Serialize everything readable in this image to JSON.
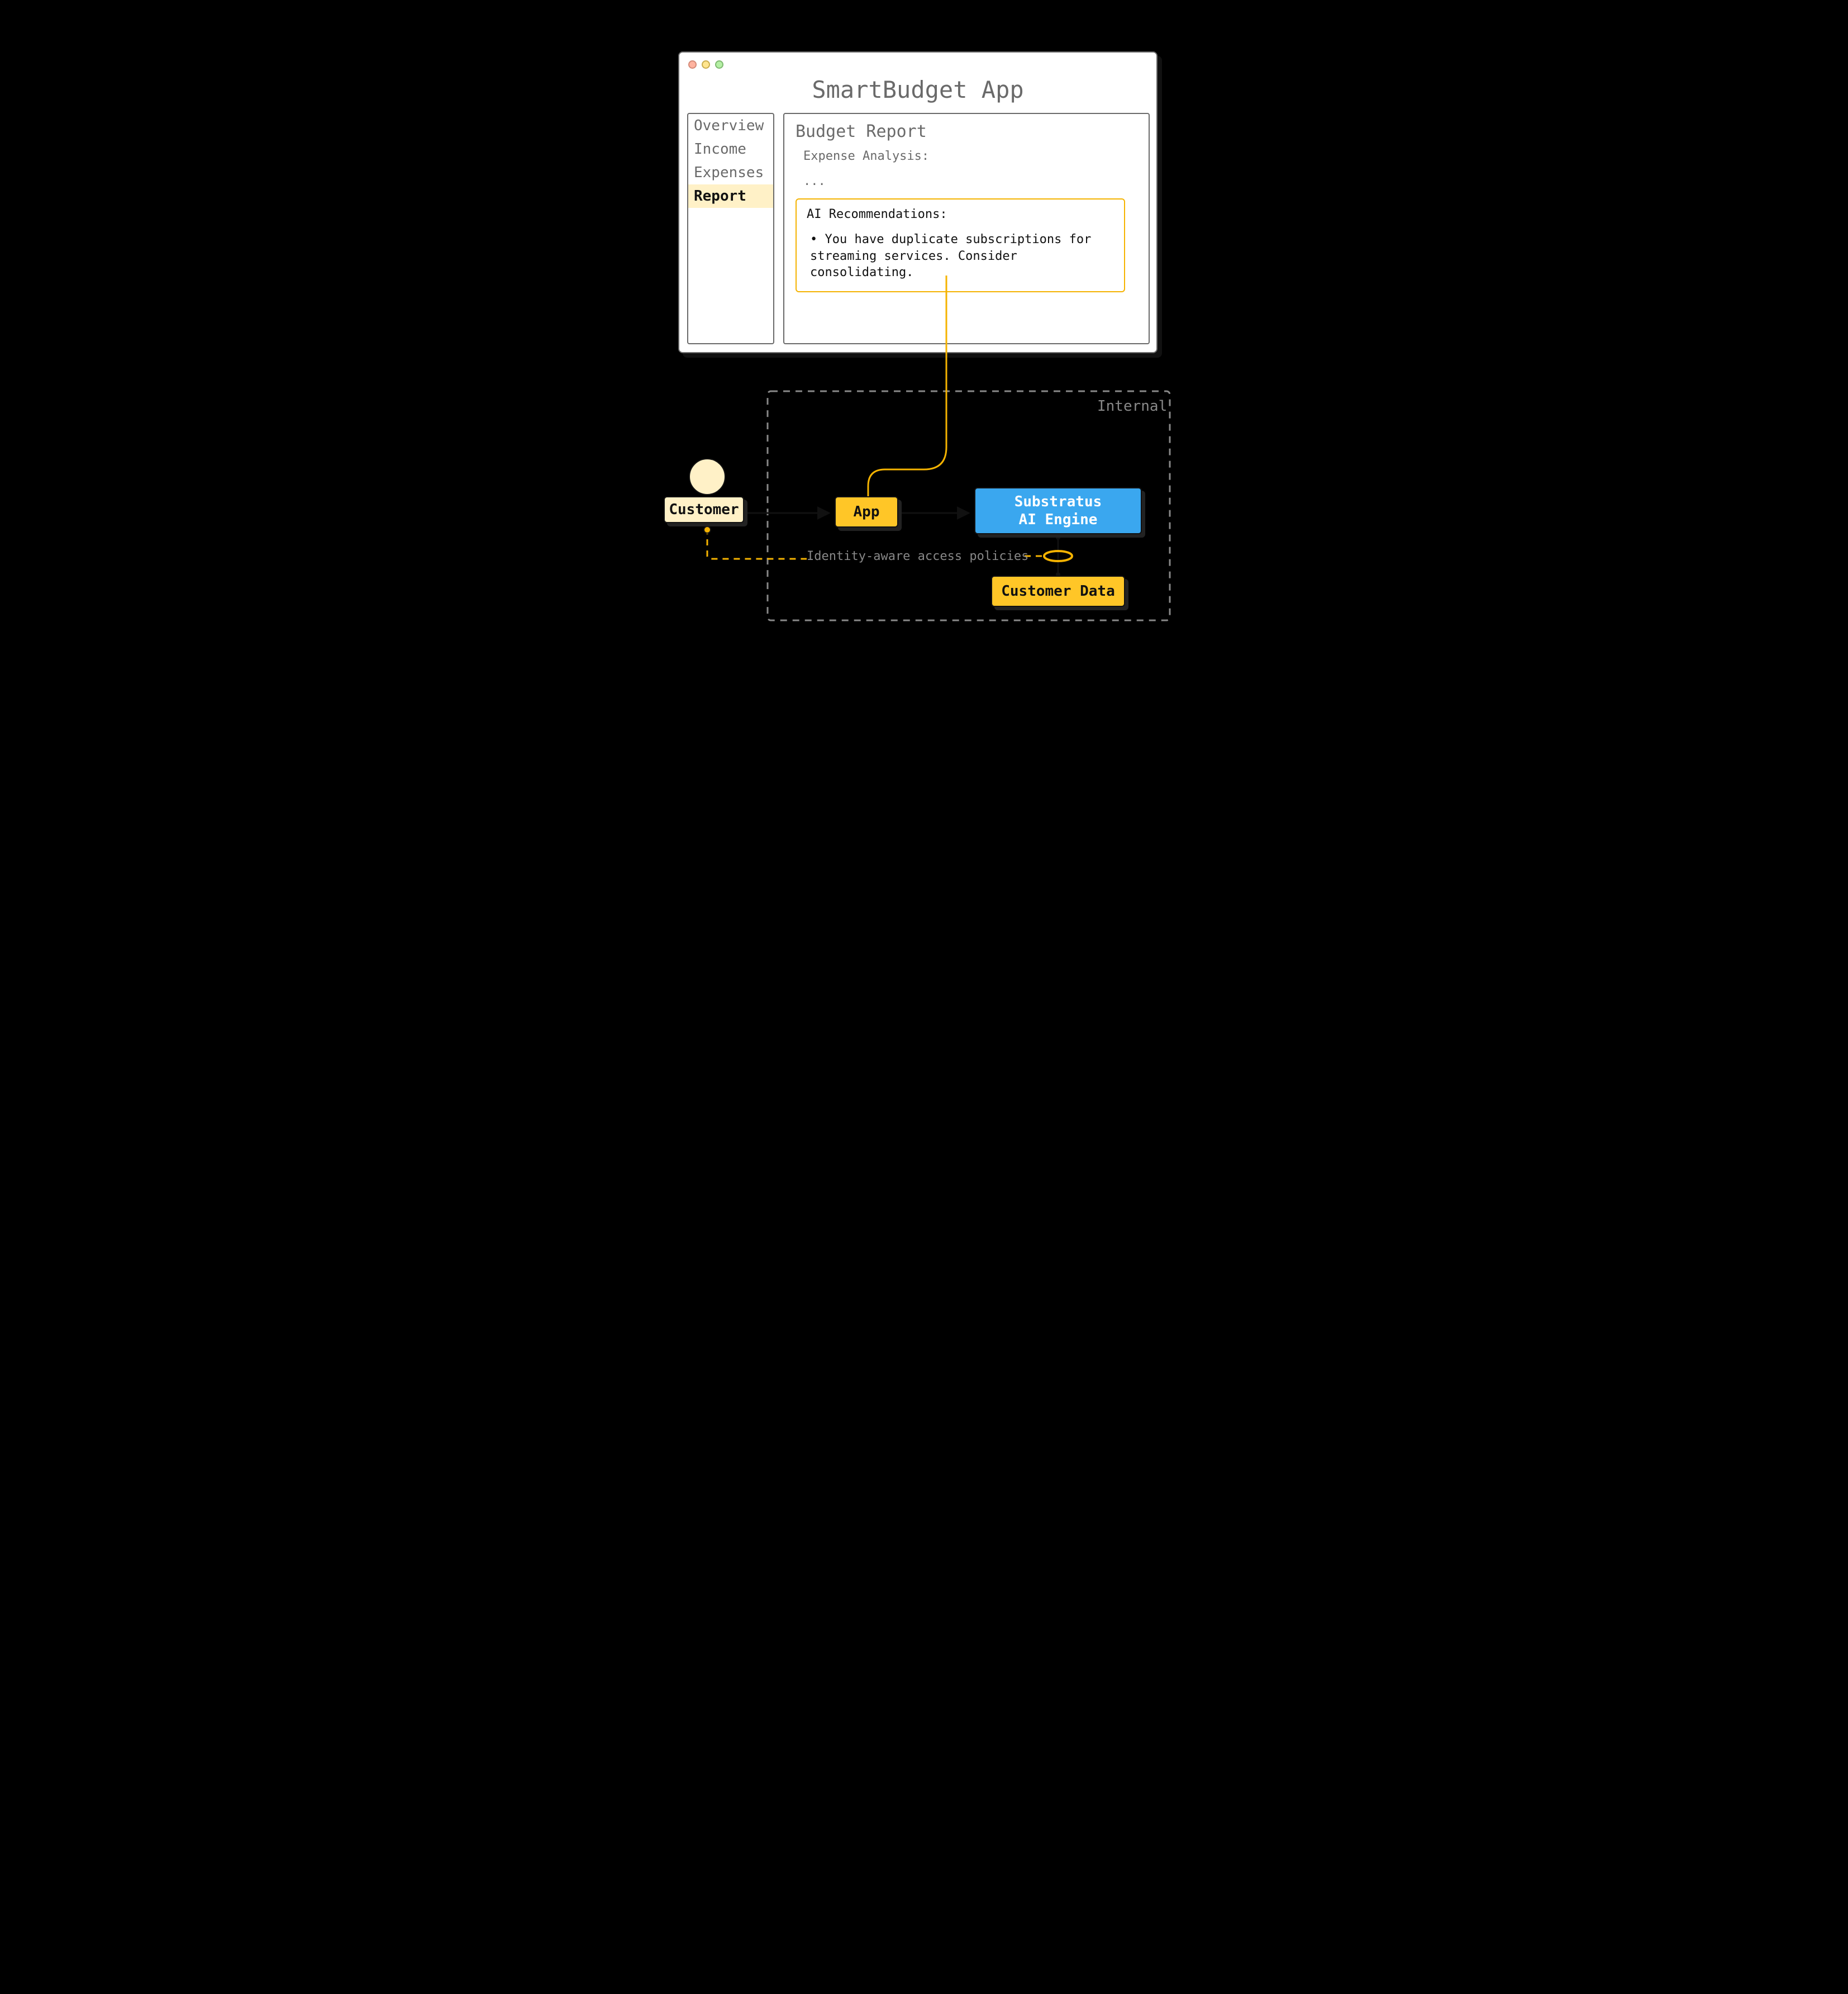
{
  "app": {
    "title": "SmartBudget App",
    "traffic_light_icons": [
      "close-icon",
      "minimize-icon",
      "zoom-icon"
    ]
  },
  "sidebar": {
    "items": [
      {
        "label": "Overview",
        "active": false
      },
      {
        "label": "Income",
        "active": false
      },
      {
        "label": "Expenses",
        "active": false
      },
      {
        "label": "Report",
        "active": true
      }
    ]
  },
  "main": {
    "title": "Budget Report",
    "subheading": "Expense Analysis:",
    "ellipsis": "...",
    "recommendations": {
      "heading": "AI Recommendations:",
      "bullet": "You have duplicate subscriptions for streaming services. Consider consolidating."
    }
  },
  "architecture": {
    "internal_label": "Internal",
    "policy_label": "Identity-aware access policies",
    "nodes": {
      "customer": {
        "label": "Customer"
      },
      "app": {
        "label": "App"
      },
      "engine": {
        "label_line1": "Substratus",
        "label_line2": "AI Engine"
      },
      "data": {
        "label": "Customer Data"
      }
    }
  }
}
